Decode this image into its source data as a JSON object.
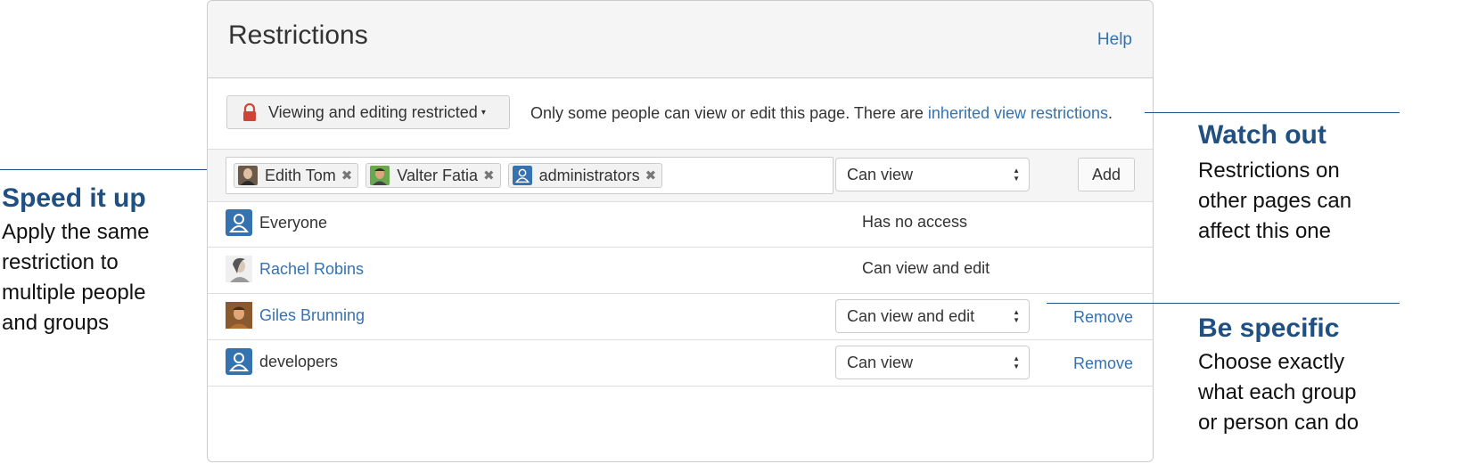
{
  "dialog": {
    "title": "Restrictions",
    "help_label": "Help",
    "mode_button_label": "Viewing and editing restricted",
    "mode_description": "Only some people can view or edit this page. There are ",
    "inherited_link": "inherited view restrictions",
    "mode_description_end": ".",
    "picker_tokens": [
      {
        "label": "Edith Tom",
        "icon": "user-avatar"
      },
      {
        "label": "Valter Fatia",
        "icon": "user-avatar"
      },
      {
        "label": "administrators",
        "icon": "group-icon"
      }
    ],
    "add_permission": "Can view",
    "add_label": "Add",
    "rows": [
      {
        "name": "Everyone",
        "permission": "Has no access",
        "icon": "group-icon"
      },
      {
        "name": "Rachel Robins",
        "permission": "Can view and edit",
        "icon": "user-avatar"
      },
      {
        "name": "Giles Brunning",
        "permission": "Can view and edit",
        "action": "Remove",
        "icon": "user-avatar"
      },
      {
        "name": "developers",
        "permission": "Can view",
        "action": "Remove",
        "icon": "group-icon"
      }
    ]
  },
  "annotations": {
    "speed": {
      "title": "Speed it up",
      "lines": [
        "Apply the same",
        "restriction to",
        "multiple people",
        "and groups"
      ]
    },
    "watch": {
      "title": "Watch out",
      "lines": [
        "Restrictions on",
        "other pages can",
        "affect this one"
      ]
    },
    "specific": {
      "title": "Be specific",
      "lines": [
        "Choose exactly",
        "what each group",
        "or person can do"
      ]
    }
  },
  "colors": {
    "link": "#3572b0",
    "annotation": "#205081",
    "lock": "#d04437"
  }
}
